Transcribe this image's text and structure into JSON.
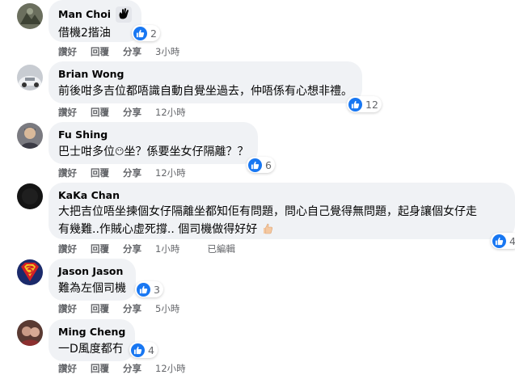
{
  "comments": [
    {
      "author": "Man Choi",
      "text": "借機2揩油",
      "reaction_count": "2",
      "actions": [
        "讚好",
        "回覆",
        "分享"
      ],
      "time": "3小時",
      "badge": "hand-wave-icon"
    },
    {
      "author": "Brian Wong",
      "text": "前後咁多吉位都唔識自動自覺坐過去，仲唔係有心想非禮。",
      "reaction_count": "12",
      "actions": [
        "讚好",
        "回覆",
        "分享"
      ],
      "time": "12小時"
    },
    {
      "author": "Fu Shing",
      "text_before": "巴士咁多位",
      "text_emoji": "😶",
      "text_after": "坐？係要坐女仔隔離？？",
      "reaction_count": "6",
      "actions": [
        "讚好",
        "回覆",
        "分享"
      ],
      "time": "12小時"
    },
    {
      "author": "KaKa Chan",
      "text_line1": "大把吉位唔坐揀個女仔隔離坐都知佢有問題，問心自己覺得無問題，起身讓個女仔走",
      "text_line2": "有幾難..作賊心虛死撐.. 個司機做得好好",
      "reaction_count": "4",
      "actions": [
        "讚好",
        "回覆",
        "分享"
      ],
      "time": "1小時",
      "edited": "已編輯"
    },
    {
      "author": "Jason Jason",
      "text": "難為左個司機",
      "reaction_count": "3",
      "actions": [
        "讚好",
        "回覆",
        "分享"
      ],
      "time": "5小時"
    },
    {
      "author": "Ming Cheng",
      "text": "一D風度都冇",
      "reaction_count": "4",
      "actions": [
        "讚好",
        "回覆",
        "分享"
      ],
      "time": "12小時"
    }
  ]
}
